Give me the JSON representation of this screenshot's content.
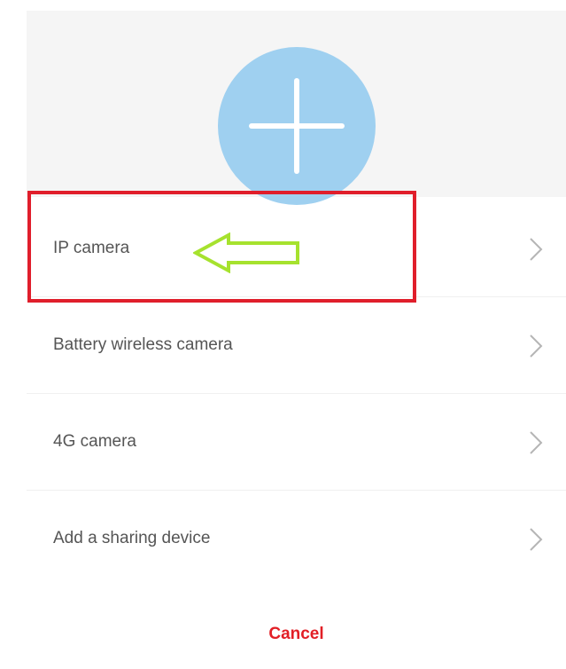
{
  "add_device": {
    "icon": "plus-icon",
    "circle_color": "#9fd0f0"
  },
  "menu": {
    "items": [
      {
        "label": "IP camera",
        "icon": "chevron-right-icon"
      },
      {
        "label": "Battery wireless camera",
        "icon": "chevron-right-icon"
      },
      {
        "label": "4G camera",
        "icon": "chevron-right-icon"
      },
      {
        "label": "Add a sharing device",
        "icon": "chevron-right-icon"
      }
    ]
  },
  "cancel_label": "Cancel",
  "colors": {
    "highlight": "#e01e2b",
    "arrow": "#a6e22e",
    "cancel": "#e21f26",
    "label": "#555555"
  }
}
